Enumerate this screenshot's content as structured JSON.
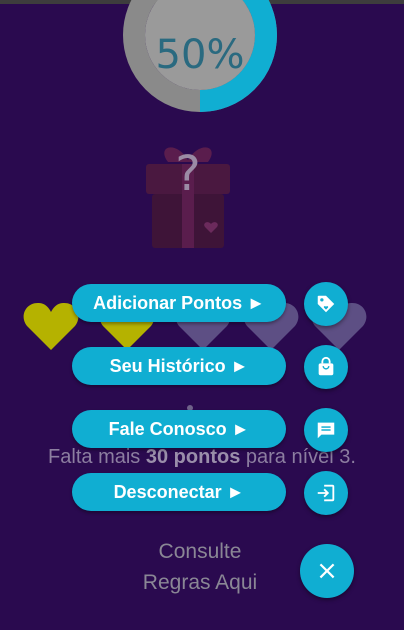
{
  "progress": {
    "percent_label": "50%",
    "percent": 50,
    "track_color": "#8a8a8a",
    "fill_color": "#10aed2"
  },
  "mystery_gift": {
    "icon": "gift-box-icon",
    "symbol": "?"
  },
  "hearts": [
    {
      "state": "filled",
      "color": "#b5b200"
    },
    {
      "state": "filled",
      "color": "#b5b200"
    },
    {
      "state": "empty",
      "color": "#5d4f84"
    },
    {
      "state": "empty",
      "color": "#5d4f84"
    },
    {
      "state": "empty",
      "color": "#5d4f84"
    }
  ],
  "level": {
    "prefix": "Falta mais ",
    "points": "30 pontos",
    "suffix": " para nível 3."
  },
  "rules_link": {
    "line1": "Consulte",
    "line2": "Regras Aqui"
  },
  "menu": {
    "items": [
      {
        "label": "Adicionar Pontos ►",
        "icon": "tag-icon"
      },
      {
        "label": "Seu Histórico ►",
        "icon": "shopping-bag-icon"
      },
      {
        "label": "Fale Conosco ►",
        "icon": "chat-icon"
      },
      {
        "label": "Desconectar ►",
        "icon": "logout-icon"
      }
    ],
    "close_icon": "close-icon",
    "close_symbol": "×",
    "accent": "#10aed2"
  }
}
